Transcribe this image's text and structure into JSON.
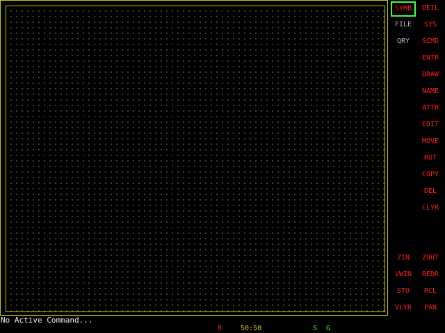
{
  "menu": {
    "left": [
      {
        "label": "SYMB",
        "state": "active"
      },
      {
        "label": "FILE",
        "state": "gray"
      },
      {
        "label": "QRY",
        "state": "gray"
      }
    ],
    "right": [
      {
        "label": "DETL"
      },
      {
        "label": "SYS"
      },
      {
        "label": "SCMD"
      },
      {
        "label": "ENTR"
      },
      {
        "label": "DRAW"
      },
      {
        "label": "NAME"
      },
      {
        "label": "ATTR"
      },
      {
        "label": "EDIT"
      },
      {
        "label": "MOVE"
      },
      {
        "label": "ROT"
      },
      {
        "label": "COPY"
      },
      {
        "label": "DEL"
      },
      {
        "label": "CLYR"
      }
    ],
    "bottom_left": [
      {
        "label": "ZIN"
      },
      {
        "label": "VWIN"
      },
      {
        "label": "STO"
      },
      {
        "label": "VLYR"
      }
    ],
    "bottom_right": [
      {
        "label": "ZOUT"
      },
      {
        "label": "REDR"
      },
      {
        "label": "RCL"
      },
      {
        "label": "PAN"
      }
    ]
  },
  "status": {
    "message": "No Active Command...",
    "r_flag": "R",
    "scale": "50:50",
    "s_flag": "S",
    "g_flag": "G"
  },
  "colors": {
    "frame": "#c8c800",
    "grid_dots": "#a0a000",
    "menu_text": "#ff2020",
    "menu_text_inactive": "#b8b8b8",
    "active_outline": "#40ff40",
    "scale_text": "#d0d000",
    "sg_text": "#40ff40"
  }
}
